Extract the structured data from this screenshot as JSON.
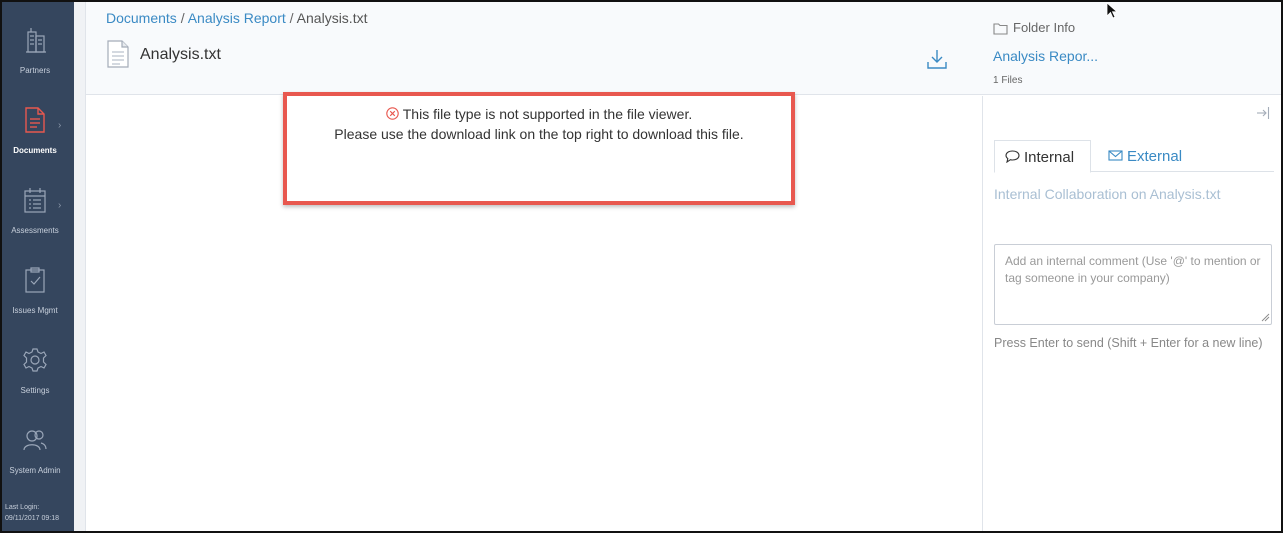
{
  "sidebar": {
    "items": [
      {
        "label": "Partners",
        "icon": "building-icon",
        "active": false,
        "has_chevron": false
      },
      {
        "label": "Documents",
        "icon": "document-icon",
        "active": true,
        "has_chevron": true
      },
      {
        "label": "Assessments",
        "icon": "calendar-list-icon",
        "active": false,
        "has_chevron": true
      },
      {
        "label": "Issues Mgmt",
        "icon": "clipboard-check-icon",
        "active": false,
        "has_chevron": false
      },
      {
        "label": "Settings",
        "icon": "gear-icon",
        "active": false,
        "has_chevron": false
      },
      {
        "label": "System Admin",
        "icon": "users-icon",
        "active": false,
        "has_chevron": false
      }
    ],
    "last_login_label": "Last Login:",
    "last_login_value": "09/11/2017 09:18"
  },
  "header": {
    "breadcrumb": {
      "items": [
        "Documents",
        "Analysis Report",
        "Analysis.txt"
      ],
      "separator": "/"
    },
    "file_title": "Analysis.txt",
    "folder_info": {
      "label": "Folder Info",
      "folder_name": "Analysis Repor...",
      "file_count": "1 Files"
    }
  },
  "viewer": {
    "alert": {
      "line1": "This file type is not supported in the file viewer.",
      "line2": "Please use the download link on the top right to download this file."
    }
  },
  "right_panel": {
    "tabs": {
      "internal": "Internal",
      "external": "External"
    },
    "collab_title": "Internal Collaboration on Analysis.txt",
    "comment_placeholder": "Add an internal comment (Use '@' to mention or tag someone in your company)",
    "send_hint": "Press Enter to send (Shift + Enter for a new line)"
  },
  "colors": {
    "sidebar_bg": "#35465e",
    "active_icon": "#e8584f",
    "link": "#3a8ac4",
    "alert_border": "#e8584f"
  }
}
